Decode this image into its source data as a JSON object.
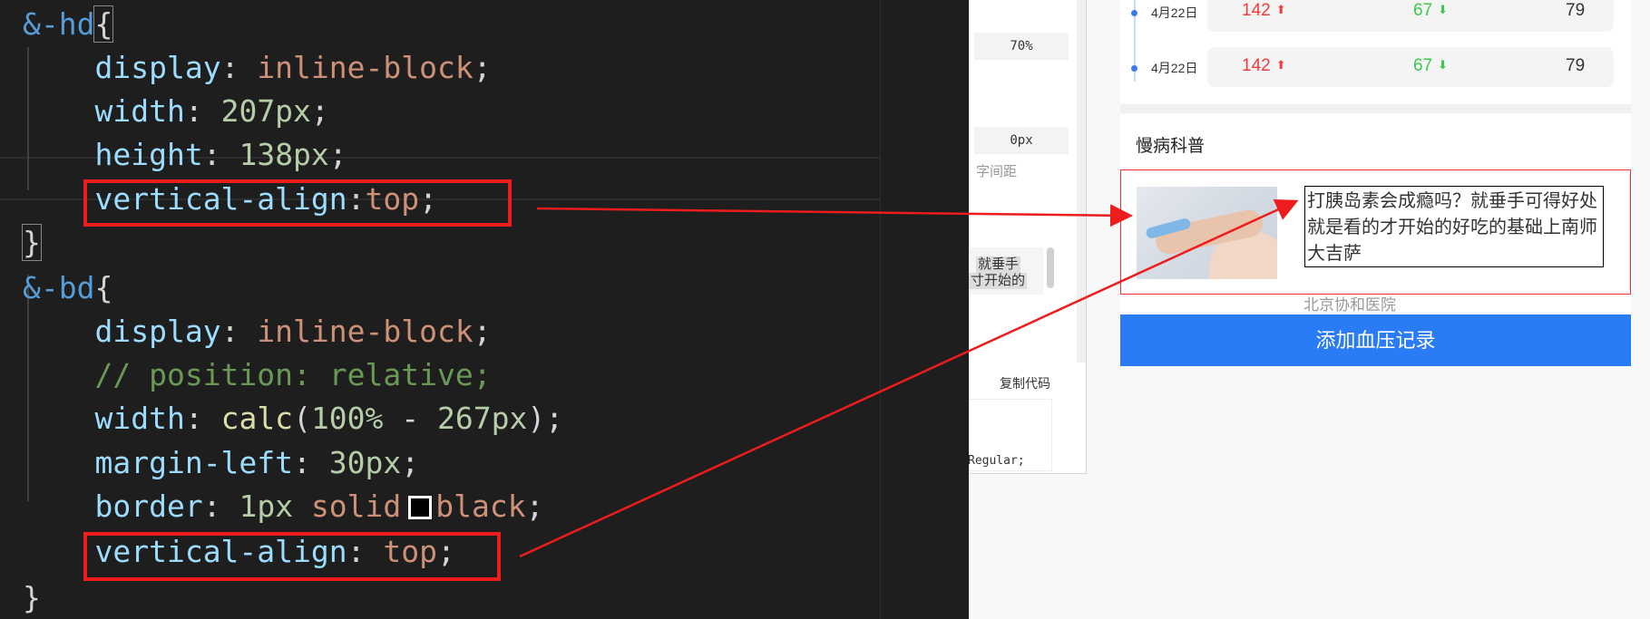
{
  "editor": {
    "lines": [
      [
        {
          "c": "t-sel",
          "t": "&-hd"
        },
        {
          "c": "t-pun bracket-hl",
          "t": "{"
        }
      ],
      [
        {
          "c": "t-pun",
          "t": "    "
        },
        {
          "c": "t-prop",
          "t": "display"
        },
        {
          "c": "t-pun",
          "t": ": "
        },
        {
          "c": "t-val",
          "t": "inline-block"
        },
        {
          "c": "t-pun",
          "t": ";"
        }
      ],
      [
        {
          "c": "t-pun",
          "t": "    "
        },
        {
          "c": "t-prop",
          "t": "width"
        },
        {
          "c": "t-pun",
          "t": ": "
        },
        {
          "c": "t-num",
          "t": "207px"
        },
        {
          "c": "t-pun",
          "t": ";"
        }
      ],
      [
        {
          "c": "t-pun",
          "t": "    "
        },
        {
          "c": "t-prop",
          "t": "height"
        },
        {
          "c": "t-pun",
          "t": ": "
        },
        {
          "c": "t-num",
          "t": "138px"
        },
        {
          "c": "t-pun",
          "t": ";"
        }
      ],
      [
        {
          "c": "t-pun",
          "t": "    "
        },
        {
          "c": "t-prop",
          "t": "vertical-align"
        },
        {
          "c": "t-pun",
          "t": ":"
        },
        {
          "c": "t-val",
          "t": "top"
        },
        {
          "c": "t-pun",
          "t": ";"
        }
      ],
      [
        {
          "c": "t-pun bracket-hl",
          "t": "}"
        }
      ],
      [
        {
          "c": "t-sel",
          "t": "&-bd"
        },
        {
          "c": "t-pun",
          "t": "{"
        }
      ],
      [
        {
          "c": "t-pun",
          "t": "    "
        },
        {
          "c": "t-prop",
          "t": "display"
        },
        {
          "c": "t-pun",
          "t": ": "
        },
        {
          "c": "t-val",
          "t": "inline-block"
        },
        {
          "c": "t-pun",
          "t": ";"
        }
      ],
      [
        {
          "c": "t-pun",
          "t": "    "
        },
        {
          "c": "t-com",
          "t": "// position: relative;"
        }
      ],
      [
        {
          "c": "t-pun",
          "t": "    "
        },
        {
          "c": "t-prop",
          "t": "width"
        },
        {
          "c": "t-pun",
          "t": ": "
        },
        {
          "c": "t-fn",
          "t": "calc"
        },
        {
          "c": "t-pun",
          "t": "("
        },
        {
          "c": "t-num",
          "t": "100%"
        },
        {
          "c": "t-pun",
          "t": " - "
        },
        {
          "c": "t-num",
          "t": "267px"
        },
        {
          "c": "t-pun",
          "t": ");"
        }
      ],
      [
        {
          "c": "t-pun",
          "t": "    "
        },
        {
          "c": "t-prop",
          "t": "margin-left"
        },
        {
          "c": "t-pun",
          "t": ": "
        },
        {
          "c": "t-num",
          "t": "30px"
        },
        {
          "c": "t-pun",
          "t": ";"
        }
      ],
      [
        {
          "c": "t-pun",
          "t": "    "
        },
        {
          "c": "t-prop",
          "t": "border"
        },
        {
          "c": "t-pun",
          "t": ": "
        },
        {
          "c": "t-num",
          "t": "1px"
        },
        {
          "c": "t-pun",
          "t": " "
        },
        {
          "c": "t-val",
          "t": "solid"
        },
        {
          "c": "swatch",
          "t": ""
        },
        {
          "c": "t-val",
          "t": "black"
        },
        {
          "c": "t-pun",
          "t": ";"
        }
      ],
      [
        {
          "c": "t-pun",
          "t": "    "
        },
        {
          "c": "t-prop",
          "t": "vertical-align"
        },
        {
          "c": "t-pun",
          "t": ": "
        },
        {
          "c": "t-val",
          "t": "top"
        },
        {
          "c": "t-pun",
          "t": ";"
        }
      ],
      [
        {
          "c": "t-pun",
          "t": "}"
        }
      ]
    ]
  },
  "devpanel": {
    "opacity_value": "70%",
    "letter_spacing_value": "0px",
    "letter_spacing_label": "字间距",
    "preview_line1": "就垂手",
    "preview_line2": "寸开始的",
    "copy_code_label": "复制代码",
    "code_snippet": "Regular;"
  },
  "phone": {
    "records": [
      {
        "date": "4月22日",
        "systolic": "142",
        "diastolic": "67",
        "pulse": "79"
      },
      {
        "date": "4月22日",
        "systolic": "142",
        "diastolic": "67",
        "pulse": "79"
      }
    ],
    "arrow_up": "⬆",
    "arrow_down": "⬇",
    "section_title": "慢病科普",
    "article": {
      "title": "打胰岛素会成瘾吗？就垂手可得好处就是看的才开始的好吃的基础上南师大吉萨",
      "source": "北京协和医院"
    },
    "cta_label": "添加血压记录"
  },
  "colors": {
    "annotation_red": "#ee1c1c",
    "cta_blue": "#2a7cf6",
    "systolic_red": "#f23c3c",
    "diastolic_green": "#3cc84a"
  }
}
